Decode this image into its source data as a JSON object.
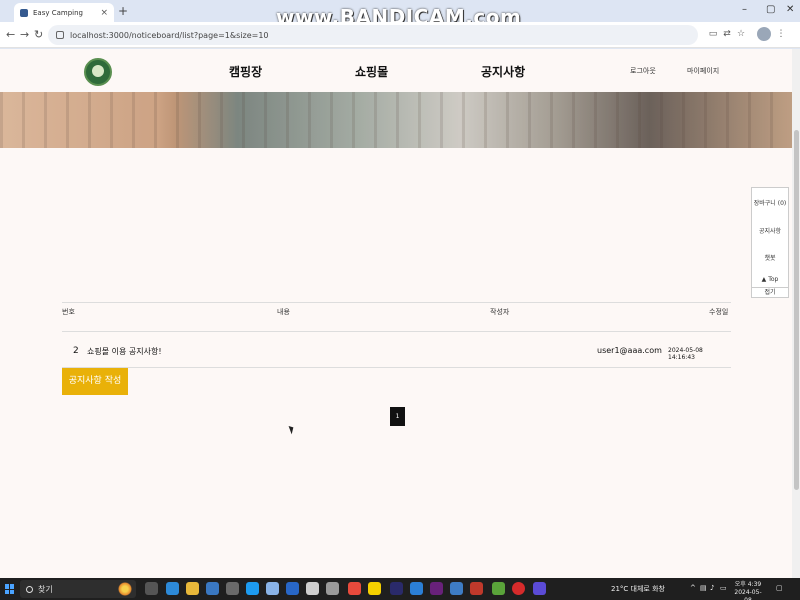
{
  "browser": {
    "tab_title": "Easy Camping",
    "tab_close": "×",
    "new_tab": "+",
    "url": "localhost:3000/noticeboard/list?page=1&size=10",
    "win_min": "–",
    "win_max": "▢",
    "win_close": "✕"
  },
  "watermark": "www.BANDICAM.com",
  "header": {
    "menu": [
      "캠핑장",
      "쇼핑몰",
      "공지사항"
    ],
    "logout": "로그아웃",
    "mypage": "마이페이지"
  },
  "quick_panel": {
    "cart": "장바구니 (0)",
    "notice": "공지사항",
    "chatbot": "챗봇",
    "top": "▲ Top",
    "fold": "접기"
  },
  "table": {
    "headers": [
      "번호",
      "내용",
      "작성자",
      "수정일"
    ],
    "rows": [
      {
        "no": "2",
        "content": "쇼핑몰 이용 공지사항!",
        "author": "user1@aaa.com",
        "date": "2024-05-08 14:16:43"
      }
    ]
  },
  "write_button": "공지사항 작성",
  "pagination": [
    "1"
  ],
  "taskbar": {
    "search_placeholder": "찾기",
    "weather": "21°C 대체로 화창",
    "time": "오후 4:39",
    "date": "2024-05-08"
  }
}
